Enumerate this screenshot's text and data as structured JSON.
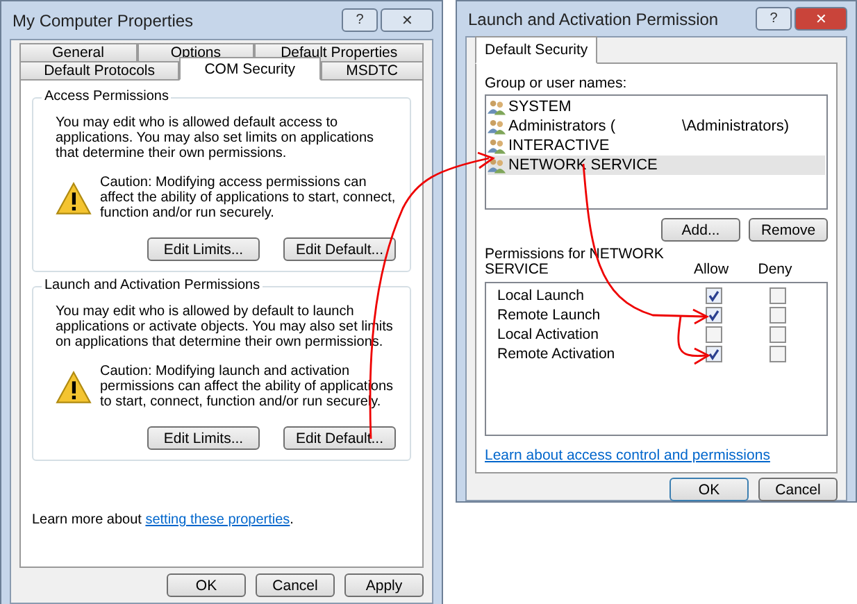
{
  "left_window": {
    "title": "My Computer Properties",
    "title_buttons": [
      "?",
      "✕"
    ],
    "tab_rows": [
      [
        {
          "label": "General",
          "selected": false
        },
        {
          "label": "Options",
          "selected": false
        },
        {
          "label": "Default Properties",
          "selected": false
        }
      ],
      [
        {
          "label": "Default Protocols",
          "selected": false
        },
        {
          "label": "COM Security",
          "selected": true
        },
        {
          "label": "MSDTC",
          "selected": false
        }
      ]
    ],
    "groups": [
      {
        "title": "Access Permissions",
        "description": "You may edit who is allowed default access to applications. You may also set limits on applications that determine their own permissions.",
        "caution": "Caution: Modifying access permissions can affect the ability of applications to start, connect, function and/or run securely.",
        "buttons": [
          "Edit Limits...",
          "Edit Default..."
        ]
      },
      {
        "title": "Launch and Activation Permissions",
        "description": "You may edit who is allowed by default to launch applications or activate objects. You may also set limits on applications that determine their own permissions.",
        "caution": "Caution: Modifying launch and activation permissions can affect the ability of applications to start, connect, function and/or run securely.",
        "buttons": [
          "Edit Limits...",
          "Edit Default..."
        ]
      }
    ],
    "learn_more": {
      "text": "Learn more about ",
      "link": "setting these properties",
      "end": "."
    },
    "buttons": [
      "OK",
      "Cancel",
      "Apply"
    ]
  },
  "right_window": {
    "title": "Launch and Activation Permission",
    "title_buttons": [
      "?",
      "✕"
    ],
    "tabs": [
      {
        "label": "Default Security",
        "selected": true
      }
    ],
    "users_label": "Group or user names:",
    "users": [
      {
        "name": "SYSTEM",
        "selected": false
      },
      {
        "name": "Administrators (",
        "name_end": "\\Administrators)",
        "selected": false
      },
      {
        "name": "INTERACTIVE",
        "selected": false
      },
      {
        "name": "NETWORK SERVICE",
        "selected": true
      }
    ],
    "user_buttons": [
      "Add...",
      "Remove"
    ],
    "permissions_label": "Permissions for NETWORK SERVICE",
    "columns": [
      "Allow",
      "Deny"
    ],
    "permissions": [
      {
        "name": "Local Launch",
        "allow": true,
        "deny": false
      },
      {
        "name": "Remote Launch",
        "allow": true,
        "deny": false
      },
      {
        "name": "Local Activation",
        "allow": false,
        "deny": false
      },
      {
        "name": "Remote Activation",
        "allow": true,
        "deny": false
      }
    ],
    "link": "Learn about access control and permissions",
    "buttons": [
      "OK",
      "Cancel"
    ]
  }
}
